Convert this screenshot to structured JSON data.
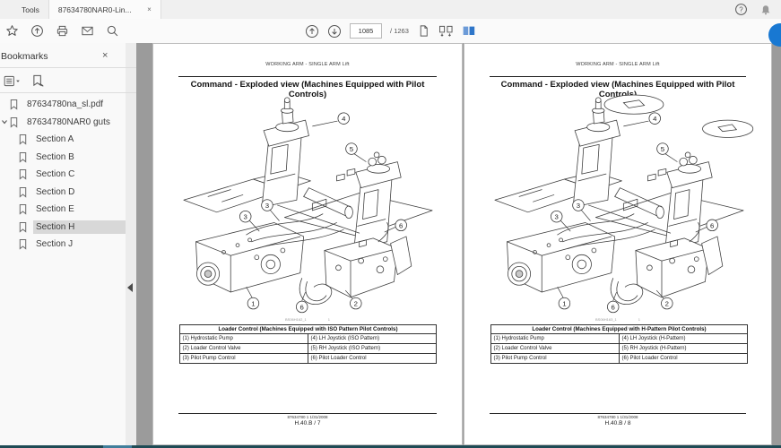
{
  "window": {
    "tools_tab": "Tools",
    "doc_tab": "87634780NAR0-Lin...",
    "doc_tab_close": "×"
  },
  "toolbar": {
    "page_current": "1085",
    "page_separator": "/",
    "page_total": "1263"
  },
  "sidebar": {
    "title": "Bookmarks",
    "close": "×",
    "bookmarks": [
      {
        "label": "87634780na_sl.pdf"
      },
      {
        "label": "87634780NAR0 guts"
      },
      {
        "label": "Section A"
      },
      {
        "label": "Section B"
      },
      {
        "label": "Section C"
      },
      {
        "label": "Section D"
      },
      {
        "label": "Section E"
      },
      {
        "label": "Section H"
      },
      {
        "label": "Section J"
      }
    ]
  },
  "diagram": {
    "callouts": [
      "4",
      "5",
      "3",
      "3",
      "1",
      "6",
      "2",
      "6"
    ]
  },
  "pages": [
    {
      "running_header": "WORKING ARM - SINGLE ARM Lift",
      "title": "Command - Exploded view (Machines Equipped with Pilot Controls)",
      "figure_code": "BS06H162_1",
      "figure_num": "1",
      "table": {
        "header": "Loader Control (Machines Equipped with ISO Pattern Pilot Controls)",
        "rows": [
          [
            "(1) Hydrostatic Pump",
            "(4) LH Joystick (ISO Pattern)"
          ],
          [
            "(2) Loader Control Valve",
            "(5) RH Joystick (ISO Pattern)"
          ],
          [
            "(3) Pilot Pump Control",
            "(6) Pilot Loader Control"
          ]
        ]
      },
      "footer_meta": "87634780 1 1/31/2008",
      "footer_page": "H.40.B / 7"
    },
    {
      "running_header": "WORKING ARM - SINGLE ARM Lift",
      "title": "Command - Exploded view (Machines Equipped with Pilot Controls)",
      "figure_code": "BS06H163_1",
      "figure_num": "1",
      "table": {
        "header": "Loader Control (Machines Equipped with H-Pattern Pilot Controls)",
        "rows": [
          [
            "(1) Hydrostatic Pump",
            "(4) LH Joystick (H-Pattern)"
          ],
          [
            "(2) Loader Control Valve",
            "(5) RH Joystick (H-Pattern)"
          ],
          [
            "(3) Pilot Pump Control",
            "(6) Pilot Loader Control"
          ]
        ]
      },
      "footer_meta": "87634780 1 1/31/2008",
      "footer_page": "H.40.B / 8"
    }
  ]
}
